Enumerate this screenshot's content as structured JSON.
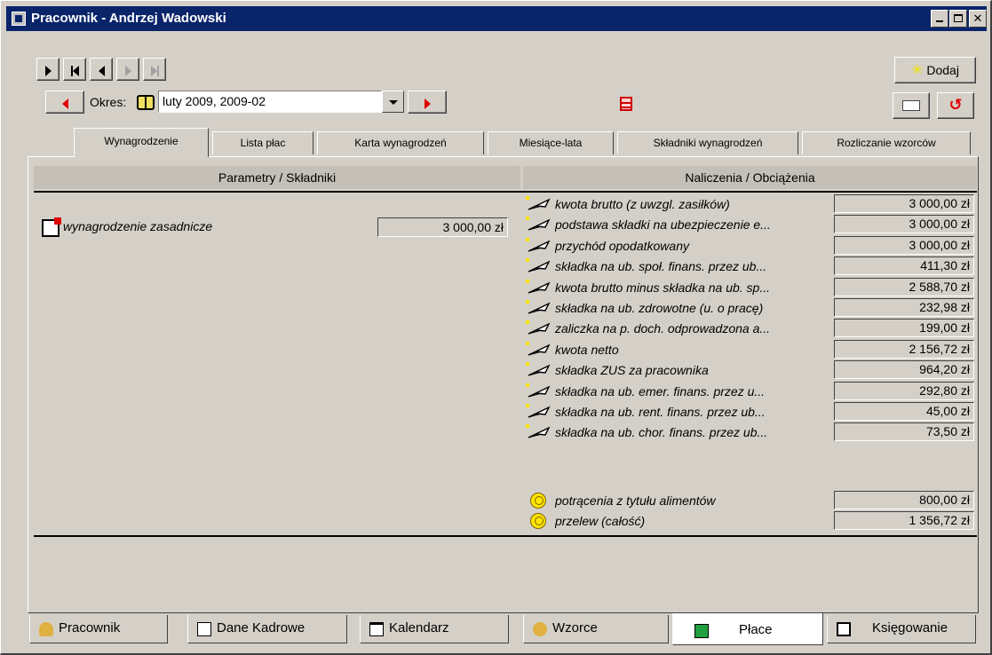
{
  "window": {
    "title": "Pracownik - Andrzej Wadowski"
  },
  "toolbar": {
    "add_label": "Dodaj"
  },
  "period": {
    "label": "Okres:",
    "value": "luty 2009, 2009-02"
  },
  "tabs": [
    {
      "label": "Wynagrodzenie",
      "active": true
    },
    {
      "label": "Lista płac",
      "active": false
    },
    {
      "label": "Karta wynagrodzeń",
      "active": false
    },
    {
      "label": "Miesiące-lata",
      "active": false
    },
    {
      "label": "Składniki wynagrodzeń",
      "active": false
    },
    {
      "label": "Rozliczanie wzorców",
      "active": false
    }
  ],
  "columns": {
    "left": "Parametry / Składniki",
    "right": "Naliczenia / Obciążenia"
  },
  "components": [
    {
      "label": "wynagrodzenie zasadnicze",
      "value": "3 000,00 zł",
      "icon": "component-icon"
    }
  ],
  "accruals": [
    {
      "label": "kwota brutto (z uwzgl. zasiłków)",
      "value": "3 000,00 zł",
      "icon": "feather-icon"
    },
    {
      "label": "podstawa składki na ubezpieczenie e...",
      "value": "3 000,00 zł",
      "icon": "feather-icon"
    },
    {
      "label": "przychód opodatkowany",
      "value": "3 000,00 zł",
      "icon": "feather-icon"
    },
    {
      "label": "składka na ub. społ. finans. przez ub...",
      "value": "411,30 zł",
      "icon": "feather-icon"
    },
    {
      "label": "kwota brutto minus składka na ub. sp...",
      "value": "2 588,70 zł",
      "icon": "feather-icon"
    },
    {
      "label": "składka na ub. zdrowotne (u. o pracę)",
      "value": "232,98 zł",
      "icon": "feather-icon"
    },
    {
      "label": "zaliczka na p. doch. odprowadzona a...",
      "value": "199,00 zł",
      "icon": "feather-icon"
    },
    {
      "label": "kwota netto",
      "value": "2 156,72 zł",
      "icon": "feather-icon"
    },
    {
      "label": "składka ZUS za pracownika",
      "value": "964,20 zł",
      "icon": "feather-icon"
    },
    {
      "label": "składka na ub. emer. finans. przez u...",
      "value": "292,80 zł",
      "icon": "feather-icon"
    },
    {
      "label": "składka na ub. rent. finans. przez ub...",
      "value": "45,00 zł",
      "icon": "feather-icon"
    },
    {
      "label": "składka na ub. chor. finans. przez ub...",
      "value": "73,50 zł",
      "icon": "feather-icon"
    }
  ],
  "deductions": [
    {
      "label": "potrącenia z tytułu alimentów",
      "value": "800,00 zł",
      "icon": "smiley-coin-icon"
    },
    {
      "label": "przelew (całość)",
      "value": "1 356,72 zł",
      "icon": "smiley-coin-icon"
    }
  ],
  "bottom_tabs": [
    {
      "label": "Pracownik",
      "icon": "person-icon",
      "active": false
    },
    {
      "label": "Dane Kadrowe",
      "icon": "document-icon",
      "active": false
    },
    {
      "label": "Kalendarz",
      "icon": "calendar-icon",
      "active": false
    },
    {
      "label": "Wzorce",
      "icon": "people-icon",
      "active": false
    },
    {
      "label": "Płace",
      "icon": "calculator-icon",
      "active": true
    },
    {
      "label": "Księgowanie",
      "icon": "ledger-icon",
      "active": false
    }
  ],
  "colors": {
    "titlebar": "#0a246a",
    "face": "#d4d0c8",
    "nav_arrow_red": "#e00000",
    "add_star": "#f0e000"
  }
}
